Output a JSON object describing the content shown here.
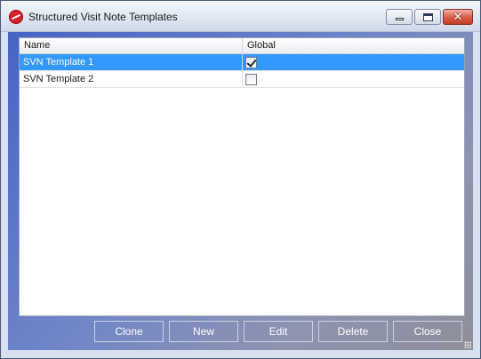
{
  "window": {
    "title": "Structured Visit Note Templates",
    "close_glyph": "✕"
  },
  "grid": {
    "columns": [
      "Name",
      "Global"
    ],
    "rows": [
      {
        "name": "SVN Template 1",
        "global": true,
        "selected": true
      },
      {
        "name": "SVN Template 2",
        "global": false,
        "selected": false
      }
    ]
  },
  "buttons": {
    "clone": "Clone",
    "new": "New",
    "edit": "Edit",
    "delete": "Delete",
    "close": "Close"
  },
  "colors": {
    "selection": "#3399ff",
    "client_gradient_start": "#4664c5",
    "client_gradient_end": "#8f8f99"
  }
}
